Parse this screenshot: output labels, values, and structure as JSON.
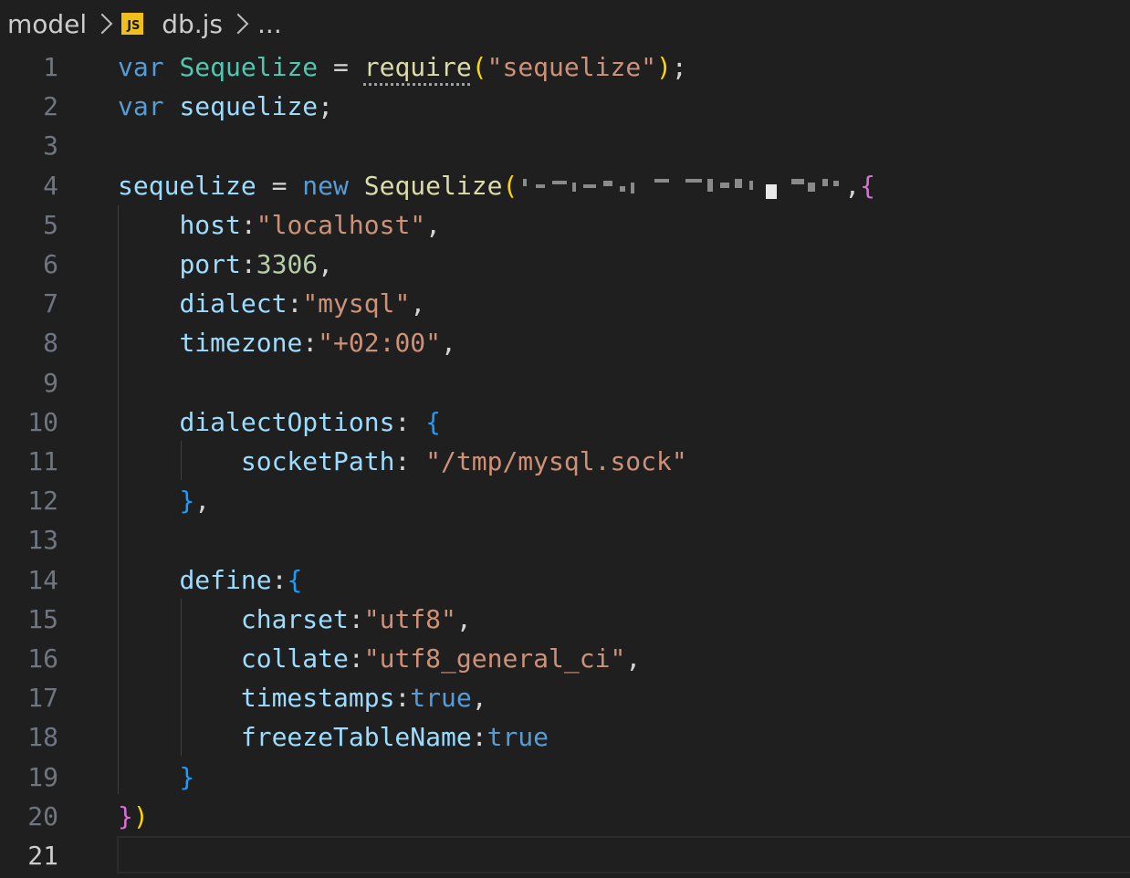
{
  "breadcrumb": {
    "folder": "model",
    "file_icon_label": "JS",
    "file": "db.js",
    "more": "..."
  },
  "editor": {
    "language": "javascript",
    "active_line": 21,
    "lines": [
      {
        "n": "1",
        "tokens": [
          [
            "kw",
            "var"
          ],
          [
            "p",
            " "
          ],
          [
            "cls",
            "Sequelize"
          ],
          [
            "p",
            " = "
          ],
          [
            "fn",
            "require"
          ],
          [
            "b1",
            "("
          ],
          [
            "str",
            "\"sequelize\""
          ],
          [
            "b1",
            ")"
          ],
          [
            "p",
            ";"
          ]
        ]
      },
      {
        "n": "2",
        "tokens": [
          [
            "kw",
            "var"
          ],
          [
            "p",
            " "
          ],
          [
            "var",
            "sequelize"
          ],
          [
            "p",
            ";"
          ]
        ]
      },
      {
        "n": "3",
        "tokens": []
      },
      {
        "n": "4",
        "tokens": [
          [
            "var",
            "sequelize"
          ],
          [
            "p",
            " = "
          ],
          [
            "kw",
            "new"
          ],
          [
            "p",
            " "
          ],
          [
            "fn",
            "Sequelize"
          ],
          [
            "b1",
            "("
          ],
          [
            "redacted",
            ""
          ],
          [
            "p",
            ","
          ],
          [
            "b2",
            "{"
          ]
        ]
      },
      {
        "n": "5",
        "tokens": [
          [
            "p",
            "    "
          ],
          [
            "var",
            "host"
          ],
          [
            "p",
            ":"
          ],
          [
            "str",
            "\"localhost\""
          ],
          [
            "p",
            ","
          ]
        ]
      },
      {
        "n": "6",
        "tokens": [
          [
            "p",
            "    "
          ],
          [
            "var",
            "port"
          ],
          [
            "p",
            ":"
          ],
          [
            "num",
            "3306"
          ],
          [
            "p",
            ","
          ]
        ]
      },
      {
        "n": "7",
        "tokens": [
          [
            "p",
            "    "
          ],
          [
            "var",
            "dialect"
          ],
          [
            "p",
            ":"
          ],
          [
            "str",
            "\"mysql\""
          ],
          [
            "p",
            ","
          ]
        ]
      },
      {
        "n": "8",
        "tokens": [
          [
            "p",
            "    "
          ],
          [
            "var",
            "timezone"
          ],
          [
            "p",
            ":"
          ],
          [
            "str",
            "\"+02:00\""
          ],
          [
            "p",
            ","
          ]
        ]
      },
      {
        "n": "9",
        "tokens": []
      },
      {
        "n": "10",
        "tokens": [
          [
            "p",
            "    "
          ],
          [
            "var",
            "dialectOptions"
          ],
          [
            "p",
            ": "
          ],
          [
            "b3",
            "{"
          ]
        ]
      },
      {
        "n": "11",
        "tokens": [
          [
            "p",
            "        "
          ],
          [
            "var",
            "socketPath"
          ],
          [
            "p",
            ": "
          ],
          [
            "str",
            "\"/tmp/mysql.sock\""
          ]
        ]
      },
      {
        "n": "12",
        "tokens": [
          [
            "p",
            "    "
          ],
          [
            "b3",
            "}"
          ],
          [
            "p",
            ","
          ]
        ]
      },
      {
        "n": "13",
        "tokens": []
      },
      {
        "n": "14",
        "tokens": [
          [
            "p",
            "    "
          ],
          [
            "var",
            "define"
          ],
          [
            "p",
            ":"
          ],
          [
            "b3",
            "{"
          ]
        ]
      },
      {
        "n": "15",
        "tokens": [
          [
            "p",
            "        "
          ],
          [
            "var",
            "charset"
          ],
          [
            "p",
            ":"
          ],
          [
            "str",
            "\"utf8\""
          ],
          [
            "p",
            ","
          ]
        ]
      },
      {
        "n": "16",
        "tokens": [
          [
            "p",
            "        "
          ],
          [
            "var",
            "collate"
          ],
          [
            "p",
            ":"
          ],
          [
            "str",
            "\"utf8_general_ci\""
          ],
          [
            "p",
            ","
          ]
        ]
      },
      {
        "n": "17",
        "tokens": [
          [
            "p",
            "        "
          ],
          [
            "var",
            "timestamps"
          ],
          [
            "p",
            ":"
          ],
          [
            "kw",
            "true"
          ],
          [
            "p",
            ","
          ]
        ]
      },
      {
        "n": "18",
        "tokens": [
          [
            "p",
            "        "
          ],
          [
            "var",
            "freezeTableName"
          ],
          [
            "p",
            ":"
          ],
          [
            "kw",
            "true"
          ]
        ]
      },
      {
        "n": "19",
        "tokens": [
          [
            "p",
            "    "
          ],
          [
            "b3",
            "}"
          ]
        ]
      },
      {
        "n": "20",
        "tokens": [
          [
            "b2",
            "}"
          ],
          [
            "b1",
            ")"
          ]
        ]
      },
      {
        "n": "21",
        "tokens": []
      }
    ]
  },
  "colors": {
    "background": "#1f1f1f",
    "keyword": "#569cd6",
    "class": "#4ec9b0",
    "variable": "#9cdcfe",
    "function": "#dcdcaa",
    "string": "#ce9178",
    "number": "#b5cea8",
    "bracket_1": "#ffd700",
    "bracket_2": "#da70d6",
    "bracket_3": "#179fff"
  }
}
